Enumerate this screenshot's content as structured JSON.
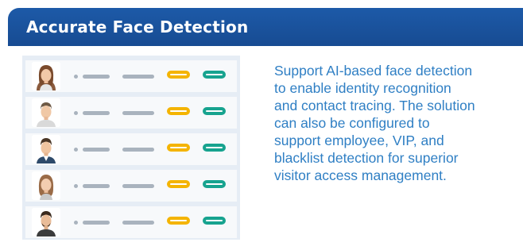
{
  "header": {
    "title": "Accurate Face Detection"
  },
  "rows": [
    {
      "avatar": "female-face-icon"
    },
    {
      "avatar": "male-face-icon"
    },
    {
      "avatar": "male-face-icon"
    },
    {
      "avatar": "female-face-icon"
    },
    {
      "avatar": "male-face-icon"
    }
  ],
  "description": "Support AI-based face detection\nto enable identity recognition\nand contact tracing. The solution\ncan also be configured to\nsupport employee, VIP, and\nblacklist detection for superior\nvisitor access management.",
  "colors": {
    "header_bg": "#1d5aa8",
    "description_text": "#2f7fc4",
    "pill_yellow": "#f4b400",
    "pill_teal": "#17a38f",
    "placeholder_gray": "#a9b3be"
  }
}
